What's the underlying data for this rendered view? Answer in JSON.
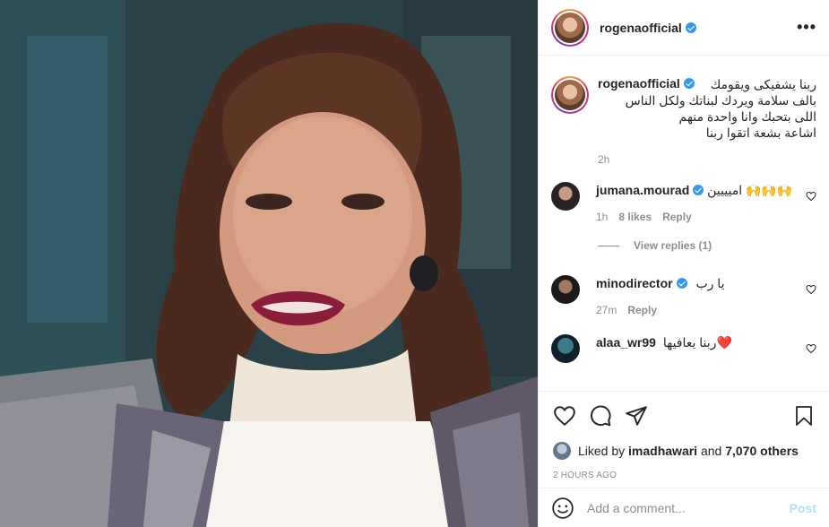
{
  "post": {
    "username": "rogenaofficial",
    "verified": true,
    "more_label": "•••",
    "caption_lines": [
      "ربنا يشفيكى ويقومك",
      "بالف سلامة ويردك لبناتك ولكل الناس",
      "اللى بتحبك وانا واحدة منهم",
      "اشاعة بشعة اتقوا ربنا"
    ],
    "caption_time": "2h"
  },
  "comments": [
    {
      "username": "jumana.mourad",
      "verified": true,
      "text": "اميييين 🙌🙌🙌",
      "time": "1h",
      "likes": "8 likes",
      "reply_label": "Reply",
      "view_replies": "View replies (1)"
    },
    {
      "username": "minodirector",
      "verified": true,
      "text": "يا رب",
      "time": "27m",
      "reply_label": "Reply"
    },
    {
      "username": "alaa_wr99",
      "verified": false,
      "text": "ربنا يعافيها❤️"
    }
  ],
  "likes": {
    "prefix": "Liked by",
    "user": "imadhawari",
    "conjunction": "and",
    "others": "7,070 others"
  },
  "timestamp": "2 HOURS AGO",
  "add_comment": {
    "placeholder": "Add a comment...",
    "post_label": "Post"
  },
  "colors": {
    "link_blue": "#3897f0",
    "post_disabled": "#b2dffc",
    "secondary_text": "#8e8e8e",
    "heart_red": "#ed4956"
  },
  "icons": [
    "heart-icon",
    "comment-icon",
    "share-icon",
    "bookmark-icon",
    "emoji-icon",
    "more-icon"
  ]
}
